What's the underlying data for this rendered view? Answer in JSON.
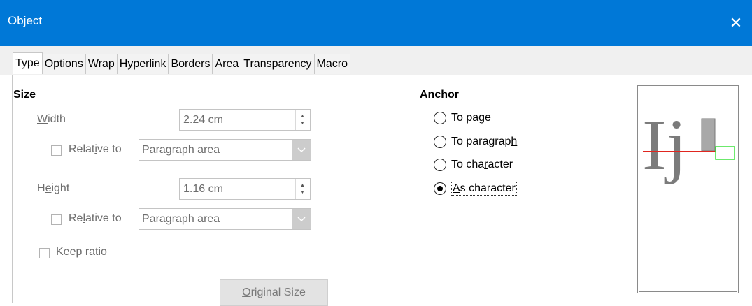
{
  "window": {
    "title": "Object",
    "close_glyph": "✕"
  },
  "tabs": [
    {
      "label": "Type",
      "active": true
    },
    {
      "label": "Options"
    },
    {
      "label": "Wrap"
    },
    {
      "label": "Hyperlink"
    },
    {
      "label": "Borders"
    },
    {
      "label": "Area"
    },
    {
      "label": "Transparency"
    },
    {
      "label": "Macro"
    }
  ],
  "size": {
    "heading": "Size",
    "width": {
      "label_pre": "",
      "label_u": "W",
      "label_post": "idth",
      "value": "2.24 cm",
      "relative_pre": "Relat",
      "relative_u": "i",
      "relative_post": "ve to",
      "relative_select": "Paragraph area",
      "relative_checked": false
    },
    "height": {
      "label_pre": "H",
      "label_u": "e",
      "label_post": "ight",
      "value": "1.16 cm",
      "relative_pre": "Re",
      "relative_u": "l",
      "relative_post": "ative to",
      "relative_select": "Paragraph area",
      "relative_checked": false
    },
    "keep_ratio_u": "K",
    "keep_ratio_post": "eep ratio",
    "keep_ratio_checked": false,
    "original_size_u": "O",
    "original_size_post": "riginal Size"
  },
  "anchor": {
    "heading": "Anchor",
    "options": [
      {
        "pre": "To ",
        "u": "p",
        "post": "age",
        "selected": false
      },
      {
        "pre": "To paragrap",
        "u": "h",
        "post": "",
        "selected": false
      },
      {
        "pre": "To cha",
        "u": "r",
        "post": "acter",
        "selected": false
      },
      {
        "pre": "",
        "u": "A",
        "post": "s character",
        "selected": true
      }
    ]
  },
  "preview": {
    "sample_text": "Ij"
  },
  "colors": {
    "titlebar": "#0078d7",
    "baseline": "#e0261f",
    "frame": "#3ce23c"
  }
}
